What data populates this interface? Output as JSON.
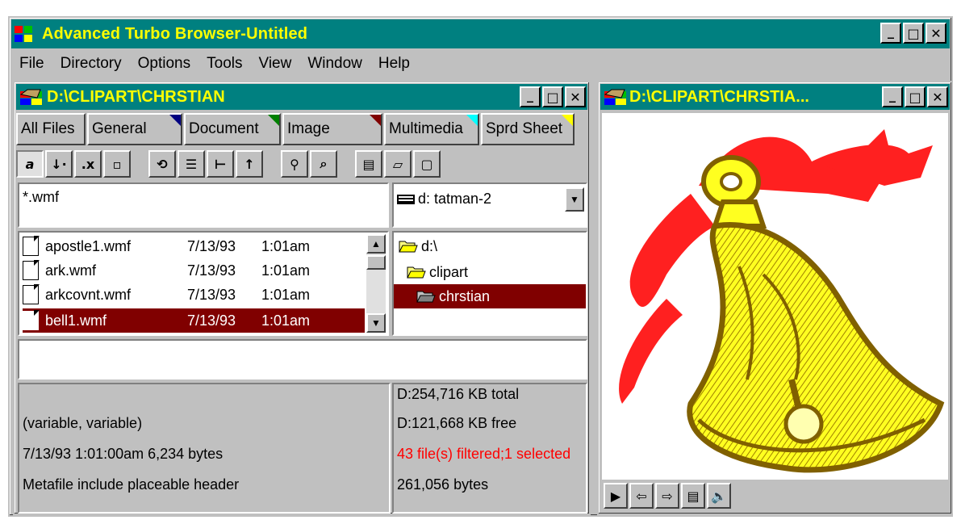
{
  "app": {
    "title": "Advanced Turbo Browser-Untitled",
    "window_controls": {
      "minimize": "_",
      "maximize": "□",
      "close": "✕"
    }
  },
  "menu": [
    {
      "label": "File"
    },
    {
      "label": "Directory"
    },
    {
      "label": "Options"
    },
    {
      "label": "Tools"
    },
    {
      "label": "View"
    },
    {
      "label": "Window"
    },
    {
      "label": "Help"
    }
  ],
  "left_window": {
    "title": "D:\\CLIPART\\CHRSTIAN",
    "tabs": [
      {
        "label": "All Files",
        "corner_color": ""
      },
      {
        "label": "General",
        "corner_color": "#000080"
      },
      {
        "label": "Document",
        "corner_color": "#008000"
      },
      {
        "label": "Image",
        "corner_color": "#800000"
      },
      {
        "label": "Multimedia",
        "corner_color": "#00ffff"
      },
      {
        "label": "Sprd Sheet",
        "corner_color": "#ffff00"
      }
    ],
    "filter": "*.wmf",
    "drive": "d:  tatman-2",
    "files": [
      {
        "name": "apostle1.wmf",
        "date": "7/13/93",
        "time": "1:01am",
        "selected": false
      },
      {
        "name": "ark.wmf",
        "date": "7/13/93",
        "time": "1:01am",
        "selected": false
      },
      {
        "name": "arkcovnt.wmf",
        "date": "7/13/93",
        "time": "1:01am",
        "selected": false
      },
      {
        "name": "bell1.wmf",
        "date": "7/13/93",
        "time": "1:01am",
        "selected": true
      }
    ],
    "directories": [
      {
        "label": "d:\\",
        "selected": false
      },
      {
        "label": "clipart",
        "selected": false
      },
      {
        "label": "chrstian",
        "selected": true
      }
    ],
    "description": "",
    "info_left": [
      "(variable, variable)",
      "7/13/93 1:01:00am 6,234 bytes",
      "Metafile include placeable header"
    ],
    "info_right": [
      {
        "text": "D:254,716 KB total",
        "color": "#000000"
      },
      {
        "text": "D:121,668 KB free",
        "color": "#000000"
      },
      {
        "text": "43 file(s) filtered;1 selected",
        "color": "#ff0000"
      },
      {
        "text": "261,056 bytes",
        "color": "#000000"
      }
    ]
  },
  "right_window": {
    "title": "D:\\CLIPART\\CHRSTIA...",
    "player_icons": [
      "play-icon",
      "prev-icon",
      "next-icon",
      "film-icon",
      "speaker-icon"
    ]
  },
  "colors": {
    "titlebar": "#008080",
    "title_text": "#ffff00",
    "selection": "#800000",
    "face": "#c0c0c0"
  }
}
